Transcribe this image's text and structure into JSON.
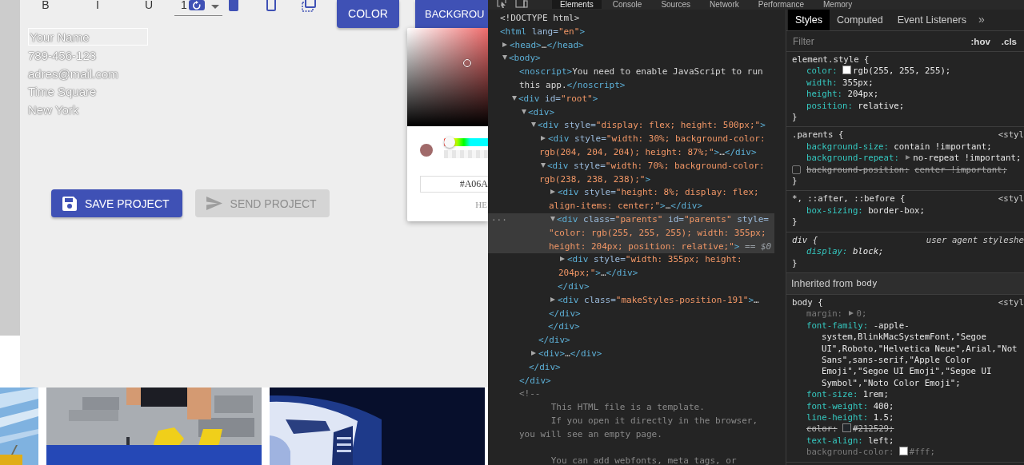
{
  "app": {
    "toolbar": {
      "format_buttons": [
        "B",
        "I",
        "U"
      ],
      "font_size": {
        "value": "1"
      },
      "color_button": "COLOR",
      "background_button": "BACKGROU"
    },
    "card": {
      "name_field": {
        "value": "Your Name"
      },
      "lines": [
        "789-456-123",
        "adres@mail.com",
        "Time Square",
        "New York"
      ]
    },
    "color_picker": {
      "color": "#a06a6a",
      "hue": {
        "level": 0
      },
      "hex_value": "#A06A",
      "format_label": "HE"
    },
    "actions": [
      {
        "kind": "save",
        "label": "SAVE PROJECT",
        "disabled": false
      },
      {
        "kind": "send",
        "label": "SEND PROJECT",
        "disabled": true
      }
    ]
  },
  "devtools": {
    "tabs": [
      {
        "label": "Elements",
        "selected": true
      },
      {
        "label": "Console",
        "selected": false
      },
      {
        "label": "Sources",
        "selected": false
      },
      {
        "label": "Network",
        "selected": false
      },
      {
        "label": "Performance",
        "selected": false
      },
      {
        "label": "Memory",
        "selected": false
      }
    ],
    "dom_tree": [
      {
        "selected": false,
        "tokens": [
          {
            "kind": "plain",
            "text": "<!DOCTYPE html>"
          }
        ]
      },
      {
        "selected": false,
        "tokens": [
          {
            "kind": "tag",
            "text": "<html"
          },
          {
            "kind": "attr",
            "text": " lang="
          },
          {
            "kind": "value",
            "text": "\"en\""
          },
          {
            "kind": "tag",
            "text": ">"
          }
        ],
        "children": [
          {
            "expandable": true,
            "expanded": false,
            "selected": false,
            "tokens": [
              {
                "kind": "tag",
                "text": "<head>"
              },
              {
                "kind": "plain",
                "text": "…"
              },
              {
                "kind": "tag",
                "text": "</head>"
              }
            ]
          },
          {
            "expandable": true,
            "expanded": true,
            "selected": false,
            "tokens": [
              {
                "kind": "tag",
                "text": "<body>"
              }
            ],
            "children": [
              {
                "selected": false,
                "tokens": [
                  {
                    "kind": "tag",
                    "text": "<noscript>"
                  },
                  {
                    "kind": "plain",
                    "text": "You need to enable JavaScript to run this app."
                  },
                  {
                    "kind": "tag",
                    "text": "</noscript>"
                  }
                ]
              },
              {
                "expandable": true,
                "expanded": true,
                "selected": false,
                "tokens": [
                  {
                    "kind": "tag",
                    "text": "<div"
                  },
                  {
                    "kind": "attr",
                    "text": " id="
                  },
                  {
                    "kind": "value",
                    "text": "\"root\""
                  },
                  {
                    "kind": "tag",
                    "text": ">"
                  }
                ],
                "close": "</div>",
                "children": [
                  {
                    "expandable": true,
                    "expanded": true,
                    "selected": false,
                    "tokens": [
                      {
                        "kind": "tag",
                        "text": "<div>"
                      }
                    ],
                    "close": "</div>",
                    "children": [
                      {
                        "expandable": true,
                        "expanded": true,
                        "selected": false,
                        "tokens": [
                          {
                            "kind": "tag",
                            "text": "<div"
                          },
                          {
                            "kind": "attr",
                            "text": " style="
                          },
                          {
                            "kind": "value",
                            "text": "\"display: flex; height: 500px;\""
                          },
                          {
                            "kind": "tag",
                            "text": ">"
                          }
                        ],
                        "close": "</div>",
                        "children": [
                          {
                            "expandable": true,
                            "expanded": false,
                            "selected": false,
                            "tokens": [
                              {
                                "kind": "tag",
                                "text": "<div"
                              },
                              {
                                "kind": "attr",
                                "text": " style="
                              },
                              {
                                "kind": "value",
                                "text": "\"width: 30%; background-color: rgb(204, 204, 204); height: 87%;\""
                              },
                              {
                                "kind": "tag",
                                "text": ">"
                              },
                              {
                                "kind": "plain",
                                "text": "…"
                              },
                              {
                                "kind": "tag",
                                "text": "</div>"
                              }
                            ]
                          },
                          {
                            "expandable": true,
                            "expanded": true,
                            "selected": false,
                            "tokens": [
                              {
                                "kind": "tag",
                                "text": "<div"
                              },
                              {
                                "kind": "attr",
                                "text": " style="
                              },
                              {
                                "kind": "value",
                                "text": "\"width: 70%; background-color: rgb(238, 238, 238);\""
                              },
                              {
                                "kind": "tag",
                                "text": ">"
                              }
                            ],
                            "close": "</div>",
                            "children": [
                              {
                                "expandable": true,
                                "expanded": false,
                                "selected": false,
                                "tokens": [
                                  {
                                    "kind": "tag",
                                    "text": "<div"
                                  },
                                  {
                                    "kind": "attr",
                                    "text": " style="
                                  },
                                  {
                                    "kind": "value",
                                    "text": "\"height: 8%; display: flex; align-items: center;\""
                                  },
                                  {
                                    "kind": "tag",
                                    "text": ">"
                                  },
                                  {
                                    "kind": "plain",
                                    "text": "…"
                                  },
                                  {
                                    "kind": "tag",
                                    "text": "</div>"
                                  }
                                ]
                              },
                              {
                                "expandable": true,
                                "expanded": true,
                                "selected": true,
                                "gutter": "...",
                                "tokens": [
                                  {
                                    "kind": "tag",
                                    "text": "<div"
                                  },
                                  {
                                    "kind": "attr",
                                    "text": " class="
                                  },
                                  {
                                    "kind": "value",
                                    "text": "\"parents\""
                                  },
                                  {
                                    "kind": "attr",
                                    "text": " id="
                                  },
                                  {
                                    "kind": "value",
                                    "text": "\"parents\""
                                  },
                                  {
                                    "kind": "attr",
                                    "text": " style="
                                  },
                                  {
                                    "kind": "value",
                                    "text": "\"color: rgb(255, 255, 255); width: 355px; height: 204px; position: relative;\""
                                  },
                                  {
                                    "kind": "tag",
                                    "text": ">"
                                  },
                                  {
                                    "kind": "marker",
                                    "text": " == $0"
                                  }
                                ],
                                "close": "</div>",
                                "children": [
                                  {
                                    "expandable": true,
                                    "expanded": false,
                                    "selected": false,
                                    "tokens": [
                                      {
                                        "kind": "tag",
                                        "text": "<div"
                                      },
                                      {
                                        "kind": "attr",
                                        "text": " style="
                                      },
                                      {
                                        "kind": "value",
                                        "text": "\"width: 355px; height: 204px;\""
                                      },
                                      {
                                        "kind": "tag",
                                        "text": ">"
                                      },
                                      {
                                        "kind": "plain",
                                        "text": "…"
                                      },
                                      {
                                        "kind": "tag",
                                        "text": "</div>"
                                      }
                                    ]
                                  }
                                ]
                              },
                              {
                                "expandable": true,
                                "expanded": false,
                                "selected": false,
                                "tokens": [
                                  {
                                    "kind": "tag",
                                    "text": "<div"
                                  },
                                  {
                                    "kind": "attr",
                                    "text": " class="
                                  },
                                  {
                                    "kind": "value",
                                    "text": "\"makeStyles-position-191\""
                                  },
                                  {
                                    "kind": "tag",
                                    "text": ">"
                                  },
                                  {
                                    "kind": "plain",
                                    "text": "…"
                                  },
                                  {
                                    "kind": "tag",
                                    "text": "</div>"
                                  }
                                ]
                              }
                            ]
                          }
                        ]
                      },
                      {
                        "expandable": true,
                        "expanded": false,
                        "selected": false,
                        "tokens": [
                          {
                            "kind": "tag",
                            "text": "<div>"
                          },
                          {
                            "kind": "plain",
                            "text": "…"
                          },
                          {
                            "kind": "tag",
                            "text": "</div>"
                          }
                        ]
                      }
                    ]
                  }
                ]
              },
              {
                "selected": false,
                "tokens": [
                  {
                    "kind": "comment",
                    "text": "<!--\n      This HTML file is a template.\n      If you open it directly in the browser, you will see an empty page.\n\n      You can add webfonts, meta tags, or"
                  }
                ]
              }
            ]
          }
        ]
      }
    ],
    "styles": {
      "tabs": [
        {
          "label": "Styles",
          "selected": true
        },
        {
          "label": "Computed",
          "selected": false
        },
        {
          "label": "Event Listeners",
          "selected": false
        }
      ],
      "more_tabs": "»",
      "filter": {
        "placeholder": "Filter"
      },
      "toggles": [
        ":hov",
        ".cls"
      ],
      "rules": [
        {
          "kind": "rule",
          "selector": "element.style {",
          "italic": false,
          "close": "}",
          "declarations": [
            {
              "property": "color:",
              "value": "rgb(255, 255, 255);",
              "color": "#ffffff",
              "expandable": false,
              "overridden": false,
              "inactive": false,
              "enabled": true
            },
            {
              "property": "width:",
              "value": "355px;",
              "expandable": false,
              "overridden": false,
              "inactive": false,
              "enabled": true
            },
            {
              "property": "height:",
              "value": "204px;",
              "expandable": false,
              "overridden": false,
              "inactive": false,
              "enabled": true
            },
            {
              "property": "position:",
              "value": "relative;",
              "expandable": false,
              "overridden": false,
              "inactive": false,
              "enabled": true
            }
          ]
        },
        {
          "kind": "rule",
          "selector": ".parents {",
          "source": "<styl",
          "italic": false,
          "close": "}",
          "declarations": [
            {
              "property": "background-size:",
              "value": "contain !important;",
              "expandable": false,
              "overridden": false,
              "inactive": false,
              "enabled": true
            },
            {
              "property": "background-repeat:",
              "value": "no-repeat !important;",
              "expandable": true,
              "overridden": false,
              "inactive": false,
              "enabled": true
            },
            {
              "property": "background-position:",
              "value": "center !important;",
              "expandable": false,
              "overridden": true,
              "inactive": false,
              "enabled": false
            }
          ]
        },
        {
          "kind": "rule",
          "selector": "*, ::after, ::before {",
          "source": "<styl",
          "italic": false,
          "close": "}",
          "declarations": [
            {
              "property": "box-sizing:",
              "value": "border-box;",
              "expandable": false,
              "overridden": false,
              "inactive": false,
              "enabled": true
            }
          ]
        },
        {
          "kind": "rule",
          "selector": "div {",
          "source": "user agent styleshe",
          "italic": true,
          "close": "}",
          "declarations": [
            {
              "property": "display:",
              "value": "block;",
              "expandable": false,
              "overridden": false,
              "inactive": false,
              "enabled": true
            }
          ]
        },
        {
          "kind": "inherited",
          "label": "Inherited from",
          "link": "body"
        },
        {
          "kind": "rule",
          "selector": "body {",
          "source": "<styl",
          "italic": false,
          "declarations": [
            {
              "property": "margin:",
              "value": "0;",
              "expandable": true,
              "overridden": false,
              "inactive": true,
              "enabled": true
            },
            {
              "property": "font-family:",
              "value_lines": [
                "-apple-",
                "system,BlinkMacSystemFont,\"Segoe",
                "UI\",Roboto,\"Helvetica Neue\",Arial,\"Not",
                "Sans\",sans-serif,\"Apple Color",
                "Emoji\",\"Segoe UI Emoji\",\"Segoe UI",
                "Symbol\",\"Noto Color Emoji\";"
              ],
              "expandable": false,
              "overridden": false,
              "inactive": false,
              "enabled": true
            },
            {
              "property": "font-size:",
              "value": "1rem;",
              "expandable": false,
              "overridden": false,
              "inactive": false,
              "enabled": true
            },
            {
              "property": "font-weight:",
              "value": "400;",
              "expandable": false,
              "overridden": false,
              "inactive": false,
              "enabled": true
            },
            {
              "property": "line-height:",
              "value": "1.5;",
              "expandable": false,
              "overridden": false,
              "inactive": false,
              "enabled": true
            },
            {
              "property": "color:",
              "value": "#212529;",
              "color": "#212529",
              "expandable": false,
              "overridden": true,
              "inactive": false,
              "enabled": true
            },
            {
              "property": "text-align:",
              "value": "left;",
              "expandable": false,
              "overridden": false,
              "inactive": false,
              "enabled": true
            },
            {
              "property": "background-color:",
              "value": "#fff;",
              "color": "#ffffff",
              "expandable": false,
              "overridden": false,
              "inactive": true,
              "enabled": true
            }
          ]
        }
      ]
    }
  }
}
